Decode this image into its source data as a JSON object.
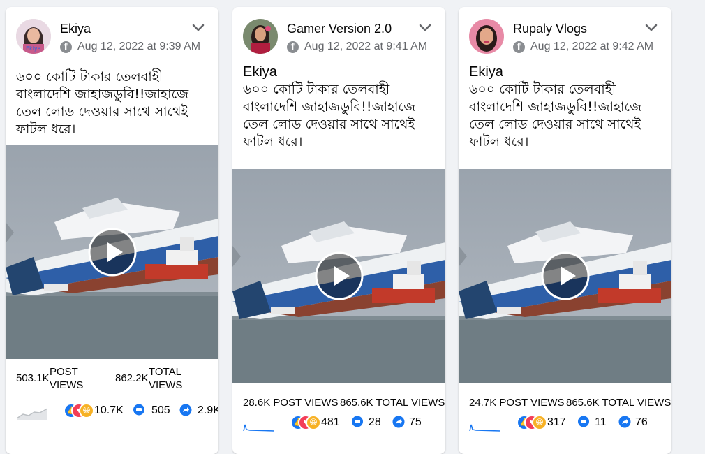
{
  "posts": [
    {
      "page_name": "Ekiya",
      "timestamp": "Aug 12, 2022 at 9:39 AM",
      "shared_author": "",
      "text": "৬০০ কোটি টাকার তেলবাহী বাংলাদেশি জাহাজডুবি!!জাহাজে তেল লোড দেওয়ার সাথে সাথেই ফাটল ধরে।",
      "post_views_value": "503.1K",
      "post_views_label": "POST VIEWS",
      "total_views_value": "862.2K",
      "total_views_label": "TOTAL VIEWS",
      "reactions": "10.7K",
      "comments": "505",
      "shares": "2.9K"
    },
    {
      "page_name": "Gamer Version 2.0",
      "timestamp": "Aug 12, 2022 at 9:41 AM",
      "shared_author": "Ekiya",
      "text": "৬০০ কোটি টাকার তেলবাহী বাংলাদেশি জাহাজডুবি!!জাহাজে তেল লোড দেওয়ার সাথে সাথেই ফাটল ধরে।",
      "post_views": "28.6K POST VIEWS",
      "total_views": "865.6K TOTAL VIEWS",
      "reactions": "481",
      "comments": "28",
      "shares": "75"
    },
    {
      "page_name": "Rupaly Vlogs",
      "timestamp": "Aug 12, 2022 at 9:42 AM",
      "shared_author": "Ekiya",
      "text": "৬০০ কোটি টাকার তেলবাহী বাংলাদেশি জাহাজডুবি!!জাহাজে তেল লোড দেওয়ার সাথে সাথেই ফাটল ধরে।",
      "post_views": "24.7K POST VIEWS",
      "total_views": "865.6K TOTAL VIEWS",
      "reactions": "317",
      "comments": "11",
      "shares": "76"
    }
  ],
  "icons": {
    "platform": "facebook-icon",
    "menu": "chevron-down-icon",
    "play": "play-icon",
    "reactions": [
      "like-icon",
      "love-icon",
      "haha-icon"
    ],
    "comment": "comment-icon",
    "share": "share-icon"
  },
  "colors": {
    "brand_blue": "#1877f2",
    "text_primary": "#050505",
    "text_secondary": "#65676b",
    "background": "#f0f2f5"
  },
  "ui_glyphs": {
    "facebook_letter": "f",
    "reaction_like": "👍",
    "reaction_love": "♥",
    "reaction_haha": "😆"
  }
}
